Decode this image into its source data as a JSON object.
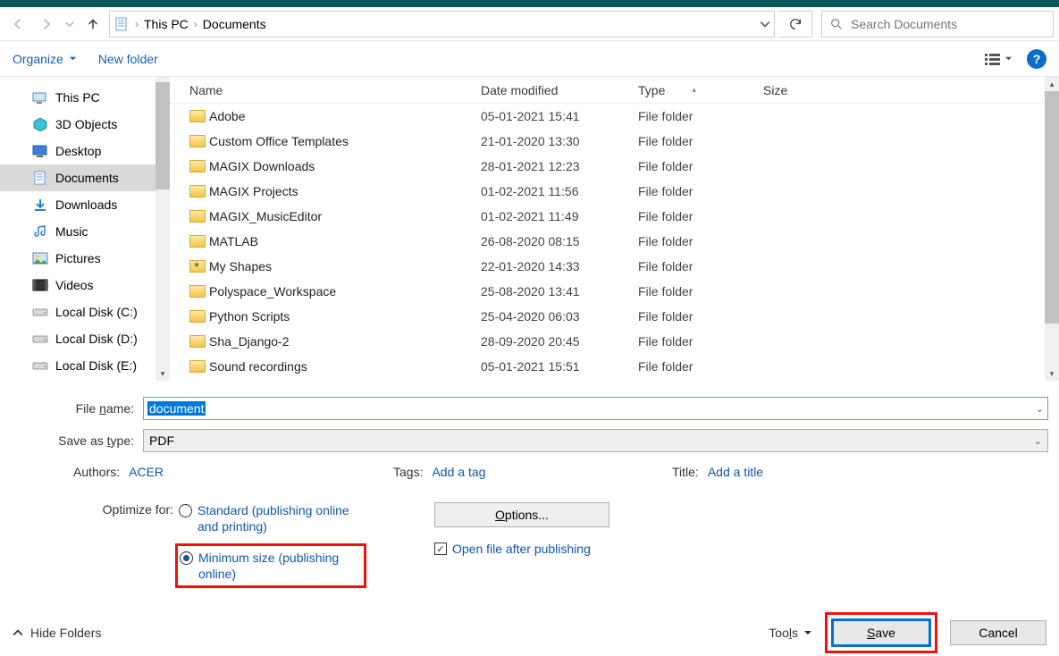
{
  "breadcrumbs": [
    "This PC",
    "Documents"
  ],
  "search": {
    "placeholder": "Search Documents"
  },
  "toolbar": {
    "organize": "Organize",
    "newfolder": "New folder"
  },
  "tree": [
    {
      "label": "This PC",
      "icon": "pc"
    },
    {
      "label": "3D Objects",
      "icon": "3d"
    },
    {
      "label": "Desktop",
      "icon": "desktop"
    },
    {
      "label": "Documents",
      "icon": "doc",
      "active": true
    },
    {
      "label": "Downloads",
      "icon": "dl"
    },
    {
      "label": "Music",
      "icon": "music"
    },
    {
      "label": "Pictures",
      "icon": "pics"
    },
    {
      "label": "Videos",
      "icon": "vid"
    },
    {
      "label": "Local Disk (C:)",
      "icon": "disk"
    },
    {
      "label": "Local Disk (D:)",
      "icon": "disk"
    },
    {
      "label": "Local Disk (E:)",
      "icon": "disk"
    }
  ],
  "columns": {
    "name": "Name",
    "modified": "Date modified",
    "type": "Type",
    "size": "Size"
  },
  "files": [
    {
      "name": "Adobe",
      "modified": "05-01-2021 15:41",
      "type": "File folder"
    },
    {
      "name": "Custom Office Templates",
      "modified": "21-01-2020 13:30",
      "type": "File folder"
    },
    {
      "name": "MAGIX Downloads",
      "modified": "28-01-2021 12:23",
      "type": "File folder"
    },
    {
      "name": "MAGIX Projects",
      "modified": "01-02-2021 11:56",
      "type": "File folder"
    },
    {
      "name": "MAGIX_MusicEditor",
      "modified": "01-02-2021 11:49",
      "type": "File folder"
    },
    {
      "name": "MATLAB",
      "modified": "26-08-2020 08:15",
      "type": "File folder"
    },
    {
      "name": "My Shapes",
      "modified": "22-01-2020 14:33",
      "type": "File folder",
      "special": true
    },
    {
      "name": "Polyspace_Workspace",
      "modified": "25-08-2020 13:41",
      "type": "File folder"
    },
    {
      "name": "Python Scripts",
      "modified": "25-04-2020 06:03",
      "type": "File folder"
    },
    {
      "name": "Sha_Django-2",
      "modified": "28-09-2020 20:45",
      "type": "File folder"
    },
    {
      "name": "Sound recordings",
      "modified": "05-01-2021 15:51",
      "type": "File folder"
    }
  ],
  "form": {
    "filename_label": "File name:",
    "filename_value": "document",
    "saveas_label": "Save as type:",
    "saveas_value": "PDF",
    "authors_label": "Authors:",
    "authors_value": "ACER",
    "tags_label": "Tags:",
    "tags_value": "Add a tag",
    "title_label": "Title:",
    "title_value": "Add a title",
    "optimize_label": "Optimize for:",
    "radio_standard": "Standard (publishing online and printing)",
    "radio_minsize": "Minimum size (publishing online)",
    "options_btn": "Options...",
    "open_after": "Open file after publishing"
  },
  "buttons": {
    "hide_folders": "Hide Folders",
    "tools": "Tools",
    "save": "Save",
    "cancel": "Cancel"
  }
}
